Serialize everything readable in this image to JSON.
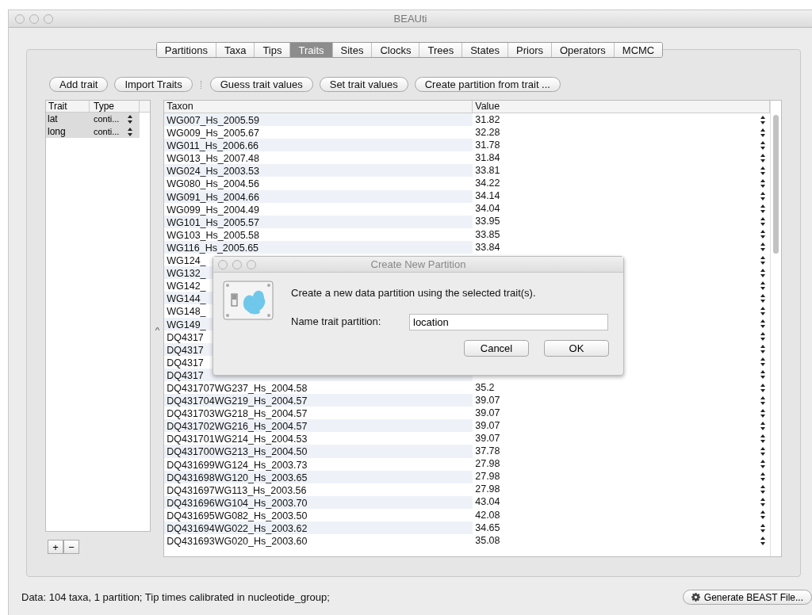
{
  "window": {
    "title": "BEAUti"
  },
  "tabs": [
    {
      "label": "Partitions",
      "selected": false
    },
    {
      "label": "Taxa",
      "selected": false
    },
    {
      "label": "Tips",
      "selected": false
    },
    {
      "label": "Traits",
      "selected": true
    },
    {
      "label": "Sites",
      "selected": false
    },
    {
      "label": "Clocks",
      "selected": false
    },
    {
      "label": "Trees",
      "selected": false
    },
    {
      "label": "States",
      "selected": false
    },
    {
      "label": "Priors",
      "selected": false
    },
    {
      "label": "Operators",
      "selected": false
    },
    {
      "label": "MCMC",
      "selected": false
    }
  ],
  "toolbar": {
    "left": [
      "Add trait",
      "Import Traits"
    ],
    "right": [
      "Guess trait values",
      "Set trait values",
      "Create partition from trait ..."
    ]
  },
  "traits_table": {
    "columns": [
      "Trait",
      "Type"
    ],
    "rows": [
      {
        "trait": "lat",
        "type": "conti...",
        "selected": true
      },
      {
        "trait": "long",
        "type": "conti...",
        "selected": true
      }
    ],
    "buttons": [
      "+",
      "−"
    ]
  },
  "taxa_table": {
    "columns": [
      "Taxon",
      "Value"
    ],
    "rows": [
      {
        "taxon": "WG007_Hs_2005.59",
        "value": "31.82"
      },
      {
        "taxon": "WG009_Hs_2005.67",
        "value": "32.28"
      },
      {
        "taxon": "WG011_Hs_2006.66",
        "value": "31.78"
      },
      {
        "taxon": "WG013_Hs_2007.48",
        "value": "31.84"
      },
      {
        "taxon": "WG024_Hs_2003.53",
        "value": "33.81"
      },
      {
        "taxon": "WG080_Hs_2004.56",
        "value": "34.22"
      },
      {
        "taxon": "WG091_Hs_2004.66",
        "value": "34.14"
      },
      {
        "taxon": "WG099_Hs_2004.49",
        "value": "34.04"
      },
      {
        "taxon": "WG101_Hs_2005.57",
        "value": "33.95"
      },
      {
        "taxon": "WG103_Hs_2005.58",
        "value": "33.85"
      },
      {
        "taxon": "WG116_Hs_2005.65",
        "value": "33.84"
      },
      {
        "taxon": "WG124_"
      },
      {
        "taxon": "WG132_"
      },
      {
        "taxon": "WG142_"
      },
      {
        "taxon": "WG144_"
      },
      {
        "taxon": "WG148_"
      },
      {
        "taxon": "WG149_"
      },
      {
        "taxon": "DQ4317"
      },
      {
        "taxon": "DQ4317"
      },
      {
        "taxon": "DQ4317"
      },
      {
        "taxon": "DQ4317"
      },
      {
        "taxon": "DQ431707WG237_Hs_2004.58",
        "value": "35.2"
      },
      {
        "taxon": "DQ431704WG219_Hs_2004.57",
        "value": "39.07"
      },
      {
        "taxon": "DQ431703WG218_Hs_2004.57",
        "value": "39.07"
      },
      {
        "taxon": "DQ431702WG216_Hs_2004.57",
        "value": "39.07"
      },
      {
        "taxon": "DQ431701WG214_Hs_2004.53",
        "value": "39.07"
      },
      {
        "taxon": "DQ431700WG213_Hs_2004.50",
        "value": "37.78"
      },
      {
        "taxon": "DQ431699WG124_Hs_2003.73",
        "value": "27.98"
      },
      {
        "taxon": "DQ431698WG120_Hs_2003.65",
        "value": "27.98"
      },
      {
        "taxon": "DQ431697WG113_Hs_2003.56",
        "value": "27.98"
      },
      {
        "taxon": "DQ431696WG104_Hs_2003.70",
        "value": "43.04"
      },
      {
        "taxon": "DQ431695WG082_Hs_2003.50",
        "value": "42.08"
      },
      {
        "taxon": "DQ431694WG022_Hs_2003.62",
        "value": "34.65"
      },
      {
        "taxon": "DQ431693WG020_Hs_2003.60",
        "value": "35.08"
      }
    ]
  },
  "dialog": {
    "title": "Create New Partition",
    "message": "Create a new data partition using the selected trait(s).",
    "field_label": "Name trait partition:",
    "field_value": "location",
    "buttons": [
      "Cancel",
      "OK"
    ]
  },
  "status_bar": {
    "text": "Data: 104 taxa, 1 partition; Tip times calibrated in nucleotide_group;",
    "button": "Generate BEAST File..."
  }
}
